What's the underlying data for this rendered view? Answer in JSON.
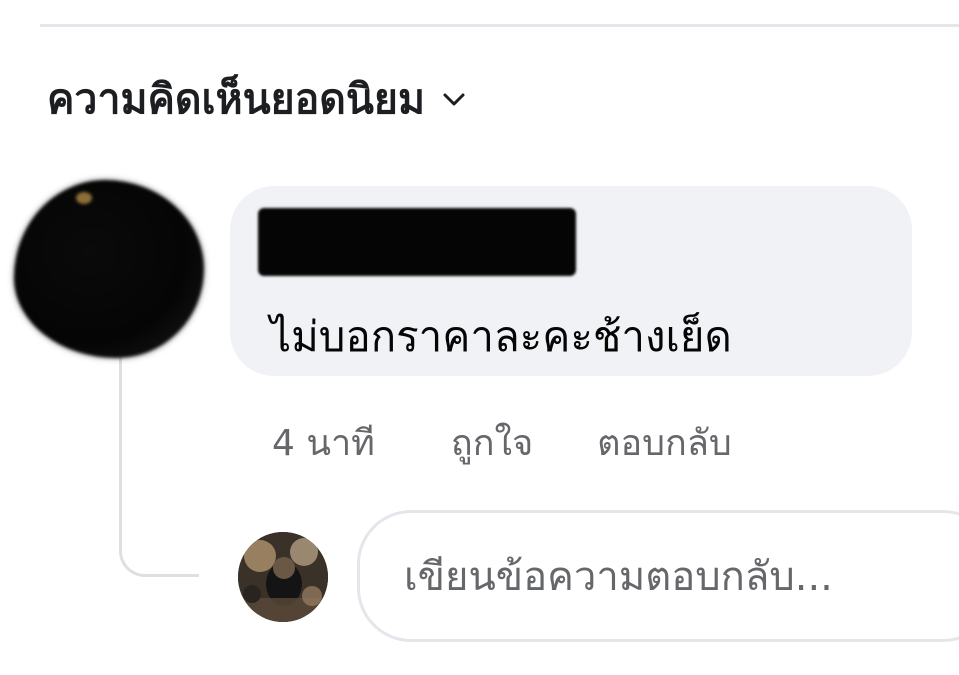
{
  "comments_section": {
    "sort_label": "ความคิดเห็นยอดนิยม",
    "sort_icon": "chevron-down-icon"
  },
  "comment": {
    "text": "ไม่บอกราคาละคะช้างเย็ด",
    "timestamp": "4 นาที",
    "like_label": "ถูกใจ",
    "reply_label": "ตอบกลับ"
  },
  "reply_box": {
    "placeholder": "เขียนข้อความตอบกลับ..."
  },
  "colors": {
    "bubble_background": "#f0f2f5",
    "secondary_text": "#65676b",
    "divider": "#e4e6eb"
  }
}
